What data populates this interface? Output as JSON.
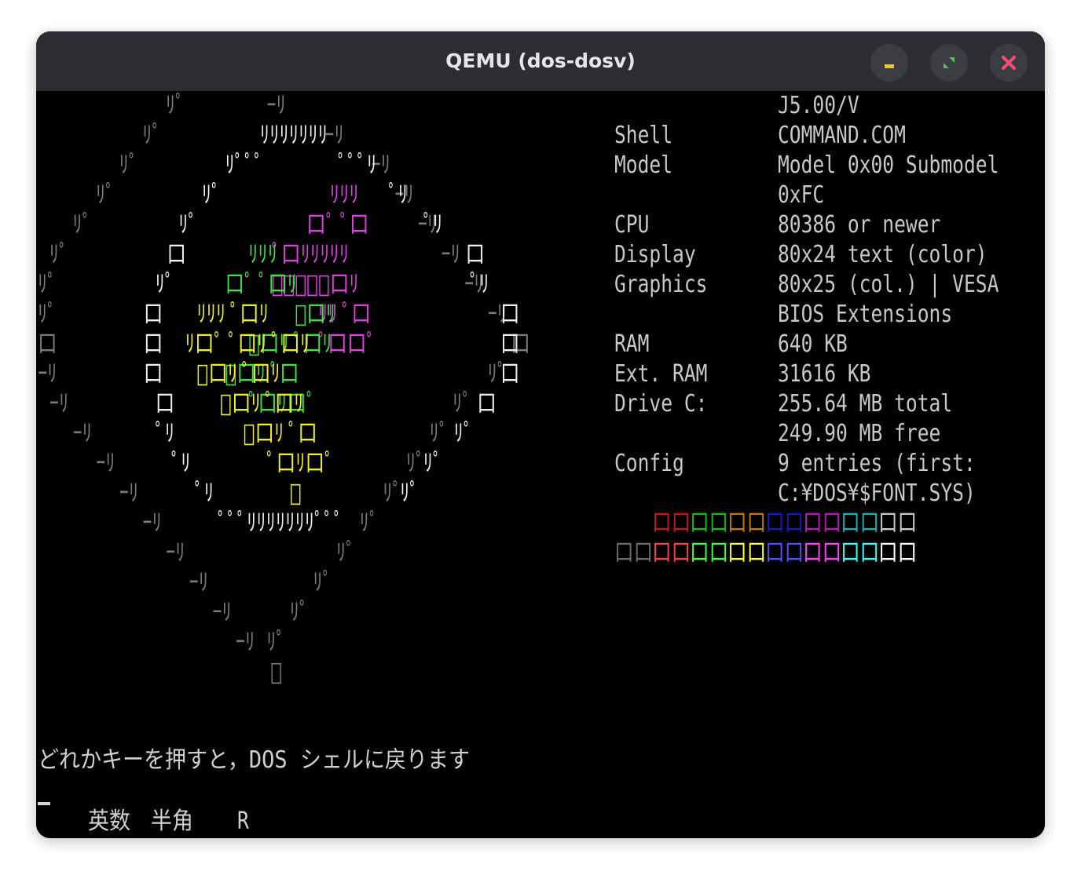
{
  "window": {
    "title": "QEMU (dos-dosv)"
  },
  "colors": {
    "titlebar": "#2c2c32",
    "close": "#ff4d6d",
    "gray": "#7c7c7c",
    "white": "#f0f0f0",
    "yellow": "#f0f020",
    "green": "#40e040",
    "magenta": "#e040e0"
  },
  "art": {
    "gray_lines": [
      "           ﾘﾟ       ｰﾘ",
      "         ﾘﾟ              ｰﾘ",
      "       ﾘﾟ                    ｰﾘ",
      "     ﾘﾟ                        ｰﾘ",
      "   ﾘﾟ                            ｰﾘ",
      " ﾘﾟ                                ｰﾘ",
      "ﾘﾟ                                   ｰﾘ",
      "ﾘﾟ                                     ｰﾘ",
      "口                                       口",
      "ｰﾘ                                     ﾘﾟ",
      " ｰﾘ                                 ﾘﾟ",
      "   ｰﾘ                             ﾘﾟ",
      "     ｰﾘ                         ﾘﾟ",
      "       ｰﾘ                     ﾘﾟ",
      "         ｰﾘ                 ﾘﾟ",
      "           ｰﾘ             ﾘﾟ",
      "             ｰﾘ         ﾘﾟ",
      "               ｰﾘ     ﾘﾟ",
      "                 ｰﾘ ﾘﾟ",
      "                    ﾟ"
    ],
    "white_lines": [
      "",
      "           ﾘﾘﾘﾘﾘﾘﾘ   ",
      "        ﾘﾟﾟﾟ       ﾟﾟﾟﾘ",
      "      ﾘﾟ               ﾟﾘ",
      "    ﾘﾟ                    ﾟﾘ",
      "   口                        口",
      "  ﾘﾟ                          ﾟﾘ",
      " 口                             口",
      " 口                             口",
      " 口                             口",
      "  口                          口",
      "  ﾟﾘ                        ﾘﾟ",
      "    ﾟﾘ                    ﾘﾟ",
      "      ﾟﾘ                ﾘﾟ",
      "        ﾟﾟﾟﾘﾘﾘﾘﾘﾘﾘﾟﾟﾟ"
    ],
    "magenta_lines": [
      "                 ﾘﾘﾘ",
      "               口ﾟ ﾟ口",
      "            ﾟ口ﾘﾘﾘﾘﾘ",
      "            ﾟﾟﾟﾟﾟ口ﾘ",
      "                ﾘﾘ ﾟ口",
      "                ﾟ口口ﾟ"
    ],
    "green_lines": [
      "          ﾘﾘﾘ",
      "        口ﾟ ﾟ口ﾘ",
      "              ﾟ口ﾘ",
      "          ﾟ口ﾘ ﾟ口ﾘ",
      "        ﾟ口ﾘ ﾟ口",
      "          ﾟ口ﾘ口ﾟ"
    ],
    "yellow_lines": [
      "   ﾘﾘﾘ ﾟ口ﾘ",
      "  ﾘ口ﾟ ﾟ口ﾘ ﾟ口ﾘ",
      "   ﾟ口ﾘ ﾟ口ﾘ",
      "     ﾟ口ﾘ ﾟ口ﾘ",
      "       ﾟ口ﾘ ﾟ口",
      "         ﾟ口ﾘ口ﾟ",
      "           ﾟ"
    ]
  },
  "info": {
    "version": "J5.00/V",
    "shell_label": "Shell",
    "shell_value": "COMMAND.COM",
    "model_label": "Model",
    "model_value": "Model 0x00 Submodel",
    "model_value2": "0xFC",
    "cpu_label": "CPU",
    "cpu_value": "80386 or newer",
    "display_label": "Display",
    "display_value": "80x24 text (color)",
    "graphics_label": "Graphics",
    "graphics_value": "80x25 (col.) | VESA",
    "graphics_value2": "BIOS Extensions",
    "ram_label": "RAM",
    "ram_value": "640 KB",
    "extram_label": "Ext. RAM",
    "extram_value": "31616 KB",
    "drive_label": "Drive C:",
    "drive_value": "255.64 MB total",
    "drive_value2": "249.90 MB free",
    "config_label": "Config",
    "config_value": "9 entries (first:",
    "config_value2": "C:¥DOS¥$FONT.SYS)"
  },
  "palette": {
    "row1": [
      "#000000",
      "#c01818",
      "#18b818",
      "#c07818",
      "#1818c0",
      "#b818b8",
      "#18b0b0",
      "#c8c8c8"
    ],
    "row2": [
      "#6c6c6c",
      "#ff4040",
      "#40ff40",
      "#ffff40",
      "#5050ff",
      "#ff40ff",
      "#40ffff",
      "#ffffff"
    ],
    "glyph": "口口"
  },
  "message": "どれかキーを押すと，DOS シェルに戻ります",
  "status": {
    "mode1": "英数",
    "mode2": "半角",
    "mode3": "R"
  }
}
